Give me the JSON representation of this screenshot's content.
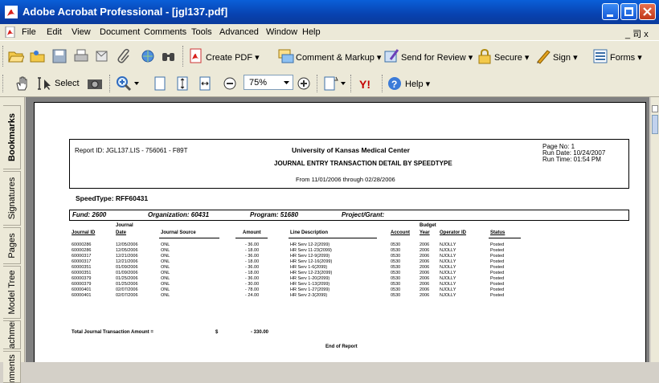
{
  "window": {
    "title": "Adobe Acrobat Professional - [jgl137.pdf]",
    "colors": {
      "titlebar": "#0842b0",
      "chrome": "#ece9d8",
      "viewer_bg": "#808080"
    }
  },
  "menu": [
    "File",
    "Edit",
    "View",
    "Document",
    "Comments",
    "Tools",
    "Advanced",
    "Window",
    "Help"
  ],
  "menu_right": "_ 司 x",
  "toolbar": {
    "create_pdf": "Create PDF ▾",
    "comment_markup": "Comment & Markup ▾",
    "send_review": "Send for Review ▾",
    "secure": "Secure ▾",
    "sign": "Sign ▾",
    "forms": "Forms ▾",
    "select": "Select",
    "zoom": "75%",
    "help": "Help ▾"
  },
  "sidebar_tabs": [
    "Bookmarks",
    "Signatures",
    "Pages",
    "Model Tree",
    "Attachments",
    "Comments"
  ],
  "report": {
    "report_id": "Report ID:  JGL137.LIS - 756061 - F89T",
    "org": "University of Kansas Medical Center",
    "title": "JOURNAL ENTRY TRANSACTION DETAIL BY SPEEDTYPE",
    "range": "From 11/01/2006 through 02/28/2006",
    "page_no": "Page No: 1",
    "run_date": "Run Date:  10/24/2007",
    "run_time": "Run Time: 01:54 PM",
    "speedtype": "SpeedType:  RFF60431",
    "fund": "Fund: 2600",
    "organization": "Organization: 60431",
    "program": "Program: 51680",
    "project": "Project/Grant:",
    "columns": {
      "journal_id": "Journal ID",
      "journal_date_top": "Journal",
      "journal_date": "Date",
      "journal_source": "Journal Source",
      "amount": "Amount",
      "line_description": "Line Description",
      "account": "Account",
      "budget_top": "Budget",
      "budget_year": "Year",
      "operator": "Operator ID",
      "status": "Status"
    },
    "rows": [
      [
        "60000286",
        "12/05/2006",
        "ONL",
        "- 36.00",
        "HR Serv 12-2(2099)",
        "0530",
        "2006",
        "NJOLLY",
        "Posted"
      ],
      [
        "60000286",
        "12/05/2006",
        "ONL",
        "- 18.00",
        "HR Serv 11-23(2099)",
        "0530",
        "2006",
        "NJOLLY",
        "Posted"
      ],
      [
        "60000317",
        "12/21/2006",
        "ONL",
        "- 36.00",
        "HR Serv 12-9(2099)",
        "0530",
        "2006",
        "NJOLLY",
        "Posted"
      ],
      [
        "60000317",
        "12/21/2006",
        "ONL",
        "- 18.00",
        "HR Serv 12-16(2099)",
        "0530",
        "2006",
        "NJOLLY",
        "Posted"
      ],
      [
        "60000351",
        "01/09/2006",
        "ONL",
        "- 36.00",
        "HR Serv 1-6(2099)",
        "0530",
        "2006",
        "NJOLLY",
        "Posted"
      ],
      [
        "60000351",
        "01/09/2006",
        "ONL",
        "- 18.00",
        "HR Serv 12-23(2099)",
        "0530",
        "2006",
        "NJOLLY",
        "Posted"
      ],
      [
        "60000379",
        "01/25/2006",
        "ONL",
        "- 36.00",
        "HR Serv 1-20(2099)",
        "0530",
        "2006",
        "NJOLLY",
        "Posted"
      ],
      [
        "60000379",
        "01/25/2006",
        "ONL",
        "- 30.00",
        "HR Serv 1-13(2099)",
        "0530",
        "2006",
        "NJOLLY",
        "Posted"
      ],
      [
        "60000401",
        "02/07/2006",
        "ONL",
        "- 78.00",
        "HR Serv 1-27(2099)",
        "0530",
        "2006",
        "NJOLLY",
        "Posted"
      ],
      [
        "60000401",
        "02/07/2006",
        "ONL",
        "- 24.00",
        "HR Serv 2-3(2099)",
        "0530",
        "2006",
        "NJOLLY",
        "Posted"
      ]
    ],
    "total_label": "Total Journal Transaction Amount =",
    "total_currency": "$",
    "total_value": "- 330.00",
    "end": "End of Report"
  }
}
